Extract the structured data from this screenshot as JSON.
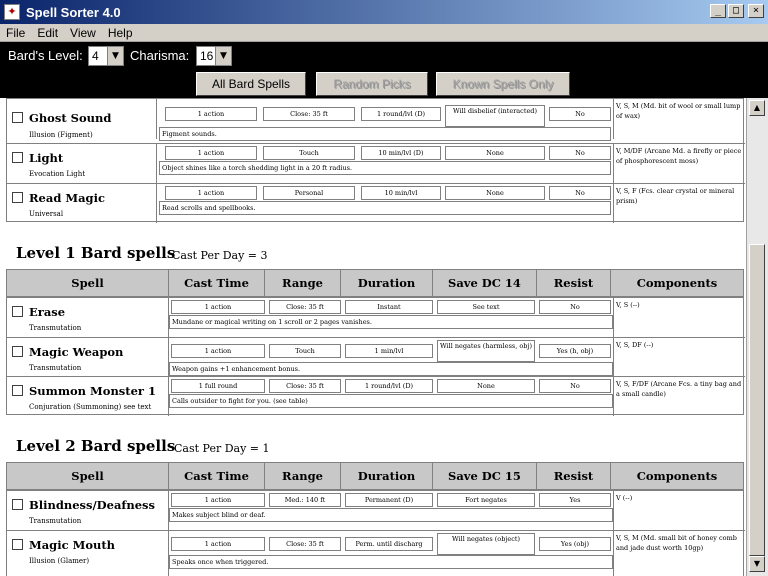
{
  "window": {
    "title": "Spell Sorter 4.0",
    "minimize": "_",
    "maximize": "□",
    "close": "×"
  },
  "menu": [
    "File",
    "Edit",
    "View",
    "Help"
  ],
  "controls": {
    "bard_level_label": "Bard's Level:",
    "bard_level_value": "4",
    "charisma_label": "Charisma:",
    "charisma_value": "16",
    "buttons": [
      "All Bard Spells",
      "Random Picks",
      "Known Spells Only"
    ]
  },
  "columns": [
    "Spell",
    "Cast Time",
    "Range",
    "Duration",
    "Save DC 14",
    "Resist",
    "Components"
  ],
  "level0": [
    {
      "name": "Ghost Sound",
      "school": "Illusion (Figment)",
      "cast": "1 action",
      "range": "Close: 35 ft",
      "duration": "1 round/lvl (D)",
      "save": "Will disbelief (interacted)",
      "resist": "No",
      "desc": "Figment sounds.",
      "components": "V, S, M (Md. bit of wool or small lump of wax)"
    },
    {
      "name": "Light",
      "school": "Evocation Light",
      "cast": "1 action",
      "range": "Touch",
      "duration": "10 min/lvl (D)",
      "save": "None",
      "resist": "No",
      "desc": "Object shines like a torch shedding light in a 20 ft radius.",
      "components": "V, M/DF (Arcane Md. a firefly or piece of phosphorescent moss)"
    },
    {
      "name": "Read Magic",
      "school": "Universal",
      "cast": "1 action",
      "range": "Personal",
      "duration": "10 min/lvl",
      "save": "None",
      "resist": "No",
      "desc": "Read scrolls and spellbooks.",
      "components": "V, S, F (Fcs. clear crystal or mineral prism)"
    }
  ],
  "level1": {
    "title": "Level 1 Bard spells",
    "cast_per_day": "Cast Per Day = 3",
    "save_header": "Save DC 14",
    "spells": [
      {
        "name": "Erase",
        "school": "Transmutation",
        "cast": "1 action",
        "range": "Close: 35 ft",
        "duration": "Instant",
        "save": "See text",
        "resist": "No",
        "desc": "Mundane or magical writing on 1 scroll or 2 pages vanishes.",
        "components": "V, S (--)"
      },
      {
        "name": "Magic Weapon",
        "school": "Transmutation",
        "cast": "1 action",
        "range": "Touch",
        "duration": "1 min/lvl",
        "save": "Will negates (harmless, obj)",
        "resist": "Yes (h, obj)",
        "desc": "Weapon gains +1 enhancement bonus.",
        "components": "V, S, DF (--)"
      },
      {
        "name": "Summon Monster 1",
        "school": "Conjuration (Summoning) see text",
        "cast": "1 full round",
        "range": "Close: 35 ft",
        "duration": "1 round/lvl (D)",
        "save": "None",
        "resist": "No",
        "desc": "Calls outsider to fight for you. (see table)",
        "components": "V, S, F/DF (Arcane Fcs. a tiny bag and a small candle)"
      }
    ]
  },
  "level2": {
    "title": "Level 2 Bard spells",
    "cast_per_day": "Cast Per Day = 1",
    "save_header": "Save DC 15",
    "spells": [
      {
        "name": "Blindness/Deafness",
        "school": "Transmutation",
        "cast": "1 action",
        "range": "Med.: 140 ft",
        "duration": "Permanent (D)",
        "save": "Fort negates",
        "resist": "Yes",
        "desc": "Makes subject blind or deaf.",
        "components": "V (--)"
      },
      {
        "name": "Magic Mouth",
        "school": "Illusion (Glamer)",
        "cast": "1 action",
        "range": "Close: 35 ft",
        "duration": "Perm. until discharg",
        "save": "Will negates (object)",
        "resist": "Yes (obj)",
        "desc": "Speaks once when triggered.",
        "components": "V, S, M (Md. small bit of honey comb and jade dust worth 10gp)"
      }
    ]
  }
}
